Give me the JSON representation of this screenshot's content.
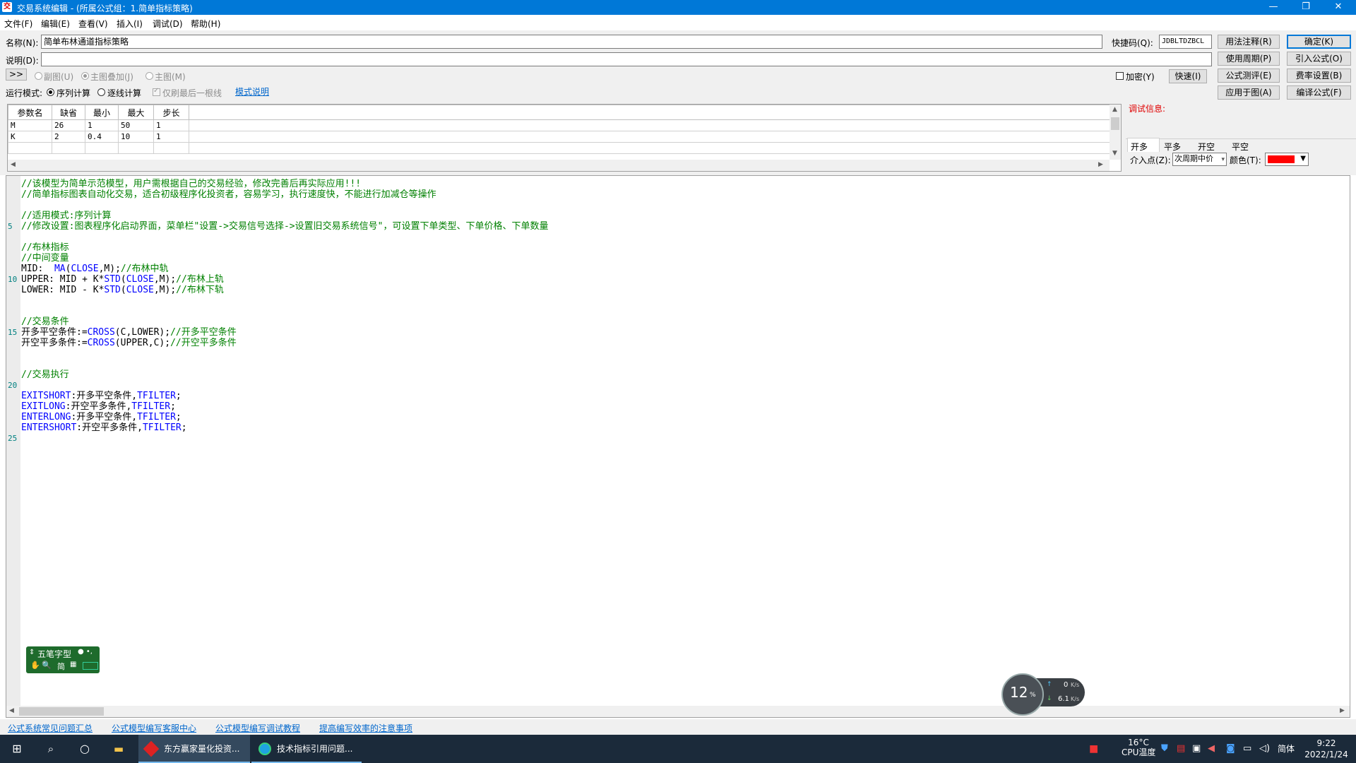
{
  "window": {
    "app_icon": "交",
    "title": "交易系统编辑 - (所属公式组：1.简单指标策略)",
    "minimize": "—",
    "restore": "❐",
    "close": "✕"
  },
  "menu": [
    "文件(F)",
    "编辑(E)",
    "查看(V)",
    "插入(I)",
    "调试(D)",
    "帮助(H)"
  ],
  "form": {
    "name_label": "名称(N):",
    "name_value": "简单布林通道指标策略",
    "shortcode_label": "快捷码(Q):",
    "shortcode_value": "JDBLTDZBCL",
    "desc_label": "说明(D):",
    "desc_value": "",
    "expand_button": ">>",
    "sub_chart": "副图(U)",
    "main_overlay": "主图叠加(J)",
    "main_chart": "主图(M)",
    "encrypt_label": "加密(Y)",
    "fast_button": "快速(I)",
    "run_mode_label": "运行模式:",
    "run_seq": "序列计算",
    "run_tick": "逐线计算",
    "last_only": "仅刷最后一根线",
    "mode_link": "模式说明",
    "debug_info": "调试信息:"
  },
  "buttons": {
    "usage": "用法注释(R)",
    "ok": "确定(K)",
    "period": "使用周期(P)",
    "import": "引入公式(O)",
    "test": "公式测评(E)",
    "fee": "费率设置(B)",
    "apply": "应用于图(A)",
    "compile": "编译公式(F)"
  },
  "params": {
    "headers": [
      "参数名",
      "缺省",
      "最小",
      "最大",
      "步长"
    ],
    "rows": [
      [
        "M",
        "26",
        "1",
        "50",
        "1"
      ],
      [
        "K",
        "2",
        "0.4",
        "10",
        "1"
      ]
    ]
  },
  "trade_tabs": [
    "开多",
    "平多",
    "开空",
    "平空"
  ],
  "entry_label": "介入点(Z):",
  "entry_value": "次周期中价",
  "color_label": "颜色(T):",
  "signal_color": "#ff0000",
  "code_lines": [
    {
      "n": "",
      "segs": [
        {
          "t": "//该模型为简单示范模型，用户需根据自己的交易经验，修改完善后再实际应用!!!",
          "c": "cmt"
        }
      ]
    },
    {
      "n": "",
      "segs": [
        {
          "t": "//简单指标图表自动化交易，适合初级程序化投资者，容易学习，执行速度快，不能进行加减仓等操作",
          "c": "cmt"
        }
      ]
    },
    {
      "n": "",
      "segs": []
    },
    {
      "n": "",
      "segs": [
        {
          "t": "//适用模式:序列计算",
          "c": "cmt"
        }
      ]
    },
    {
      "n": "5",
      "segs": [
        {
          "t": "//修改设置:图表程序化启动界面，菜单栏\"设置->交易信号选择->设置旧交易系统信号\"，可设置下单类型、下单价格、下单数量",
          "c": "cmt"
        }
      ]
    },
    {
      "n": "",
      "segs": []
    },
    {
      "n": "",
      "segs": [
        {
          "t": "//布林指标",
          "c": "cmt"
        }
      ]
    },
    {
      "n": "",
      "segs": [
        {
          "t": "//中间变量",
          "c": "cmt"
        }
      ]
    },
    {
      "n": "",
      "segs": [
        {
          "t": "MID:  ",
          "c": "plain"
        },
        {
          "t": "MA",
          "c": "kw"
        },
        {
          "t": "(",
          "c": "plain"
        },
        {
          "t": "CLOSE",
          "c": "kw"
        },
        {
          "t": ",M);",
          "c": "plain"
        },
        {
          "t": "//布林中轨",
          "c": "cmt"
        }
      ]
    },
    {
      "n": "10",
      "segs": [
        {
          "t": "UPPER: MID + K*",
          "c": "plain"
        },
        {
          "t": "STD",
          "c": "kw"
        },
        {
          "t": "(",
          "c": "plain"
        },
        {
          "t": "CLOSE",
          "c": "kw"
        },
        {
          "t": ",M);",
          "c": "plain"
        },
        {
          "t": "//布林上轨",
          "c": "cmt"
        }
      ]
    },
    {
      "n": "",
      "segs": [
        {
          "t": "LOWER: MID - K*",
          "c": "plain"
        },
        {
          "t": "STD",
          "c": "kw"
        },
        {
          "t": "(",
          "c": "plain"
        },
        {
          "t": "CLOSE",
          "c": "kw"
        },
        {
          "t": ",M);",
          "c": "plain"
        },
        {
          "t": "//布林下轨",
          "c": "cmt"
        }
      ]
    },
    {
      "n": "",
      "segs": []
    },
    {
      "n": "",
      "segs": []
    },
    {
      "n": "",
      "segs": [
        {
          "t": "//交易条件",
          "c": "cmt"
        }
      ]
    },
    {
      "n": "15",
      "segs": [
        {
          "t": "开多平空条件:=",
          "c": "plain"
        },
        {
          "t": "CROSS",
          "c": "kw"
        },
        {
          "t": "(C,LOWER);",
          "c": "plain"
        },
        {
          "t": "//开多平空条件",
          "c": "cmt"
        }
      ]
    },
    {
      "n": "",
      "segs": [
        {
          "t": "开空平多条件:=",
          "c": "plain"
        },
        {
          "t": "CROSS",
          "c": "kw"
        },
        {
          "t": "(UPPER,C);",
          "c": "plain"
        },
        {
          "t": "//开空平多条件",
          "c": "cmt"
        }
      ]
    },
    {
      "n": "",
      "segs": []
    },
    {
      "n": "",
      "segs": []
    },
    {
      "n": "",
      "segs": [
        {
          "t": "//交易执行",
          "c": "cmt"
        }
      ]
    },
    {
      "n": "20",
      "segs": []
    },
    {
      "n": "",
      "segs": [
        {
          "t": "EXITSHORT",
          "c": "kw"
        },
        {
          "t": ":开多平空条件,",
          "c": "plain"
        },
        {
          "t": "TFILTER",
          "c": "kw"
        },
        {
          "t": ";",
          "c": "plain"
        }
      ]
    },
    {
      "n": "",
      "segs": [
        {
          "t": "EXITLONG",
          "c": "kw"
        },
        {
          "t": ":开空平多条件,",
          "c": "plain"
        },
        {
          "t": "TFILTER",
          "c": "kw"
        },
        {
          "t": ";",
          "c": "plain"
        }
      ]
    },
    {
      "n": "",
      "segs": [
        {
          "t": "ENTERLONG",
          "c": "kw"
        },
        {
          "t": ":开多平空条件,",
          "c": "plain"
        },
        {
          "t": "TFILTER",
          "c": "kw"
        },
        {
          "t": ";",
          "c": "plain"
        }
      ]
    },
    {
      "n": "",
      "segs": [
        {
          "t": "ENTERSHORT",
          "c": "kw"
        },
        {
          "t": ":开空平多条件,",
          "c": "plain"
        },
        {
          "t": "TFILTER",
          "c": "kw"
        },
        {
          "t": ";",
          "c": "plain"
        }
      ]
    },
    {
      "n": "25",
      "segs": []
    }
  ],
  "footer_links": [
    "公式系统常见问题汇总",
    "公式模型编写客服中心",
    "公式模型编写调试教程",
    "提高编写效率的注意事项"
  ],
  "ime": {
    "mode": "五笔字型",
    "simplified": "简"
  },
  "netmon": {
    "cpu": "12",
    "cpu_unit": "%",
    "up": "0",
    "up_unit": "K/s",
    "down": "6.1",
    "down_unit": "K/s"
  },
  "taskbar": {
    "app1": "东方赢家量化投资...",
    "app2": "技术指标引用问题...",
    "temp": "16°C",
    "temp_label": "CPU温度",
    "lang": "简体",
    "time": "9:22",
    "date": "2022/1/24"
  }
}
